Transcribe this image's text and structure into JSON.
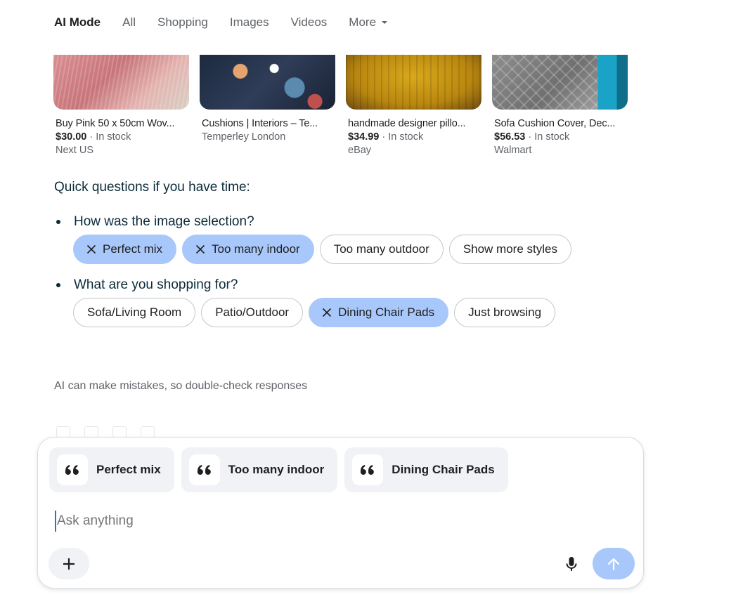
{
  "nav": {
    "items": [
      {
        "label": "AI Mode",
        "active": true
      },
      {
        "label": "All"
      },
      {
        "label": "Shopping"
      },
      {
        "label": "Images"
      },
      {
        "label": "Videos"
      }
    ],
    "more_label": "More"
  },
  "products": [
    {
      "title": "Buy Pink 50 x 50cm Wov...",
      "price": "$30.00",
      "stock": "In stock",
      "store": "Next US"
    },
    {
      "title": "Cushions | Interiors – Te...",
      "price": "",
      "stock": "",
      "store": "Temperley London"
    },
    {
      "title": "handmade designer pillo...",
      "price": "$34.99",
      "stock": "In stock",
      "store": "eBay"
    },
    {
      "title": "Sofa Cushion Cover, Dec...",
      "price": "$56.53",
      "stock": "In stock",
      "store": "Walmart"
    }
  ],
  "quick_questions": {
    "title": "Quick questions if you have time:",
    "questions": [
      {
        "text": "How was the image selection?",
        "options": [
          {
            "label": "Perfect mix",
            "selected": true
          },
          {
            "label": "Too many indoor",
            "selected": true
          },
          {
            "label": "Too many outdoor",
            "selected": false
          },
          {
            "label": "Show more styles",
            "selected": false
          }
        ]
      },
      {
        "text": "What are you shopping for?",
        "options": [
          {
            "label": "Sofa/Living Room",
            "selected": false
          },
          {
            "label": "Patio/Outdoor",
            "selected": false
          },
          {
            "label": "Dining Chair Pads",
            "selected": true
          },
          {
            "label": "Just browsing",
            "selected": false
          }
        ]
      }
    ]
  },
  "disclaimer": "AI can make mistakes, so double-check responses",
  "composer": {
    "quotes": [
      "Perfect mix",
      "Too many indoor",
      "Dining Chair Pads"
    ],
    "placeholder": "Ask anything",
    "icons": {
      "quote": "quote-icon",
      "add": "plus-icon",
      "mic": "microphone-icon",
      "send": "arrow-up-icon"
    }
  },
  "colors": {
    "selected_chip": "#a8c7fa",
    "send_button": "#a8c7fa",
    "text_dark": "#0b2a3a",
    "muted": "#5f6368"
  }
}
